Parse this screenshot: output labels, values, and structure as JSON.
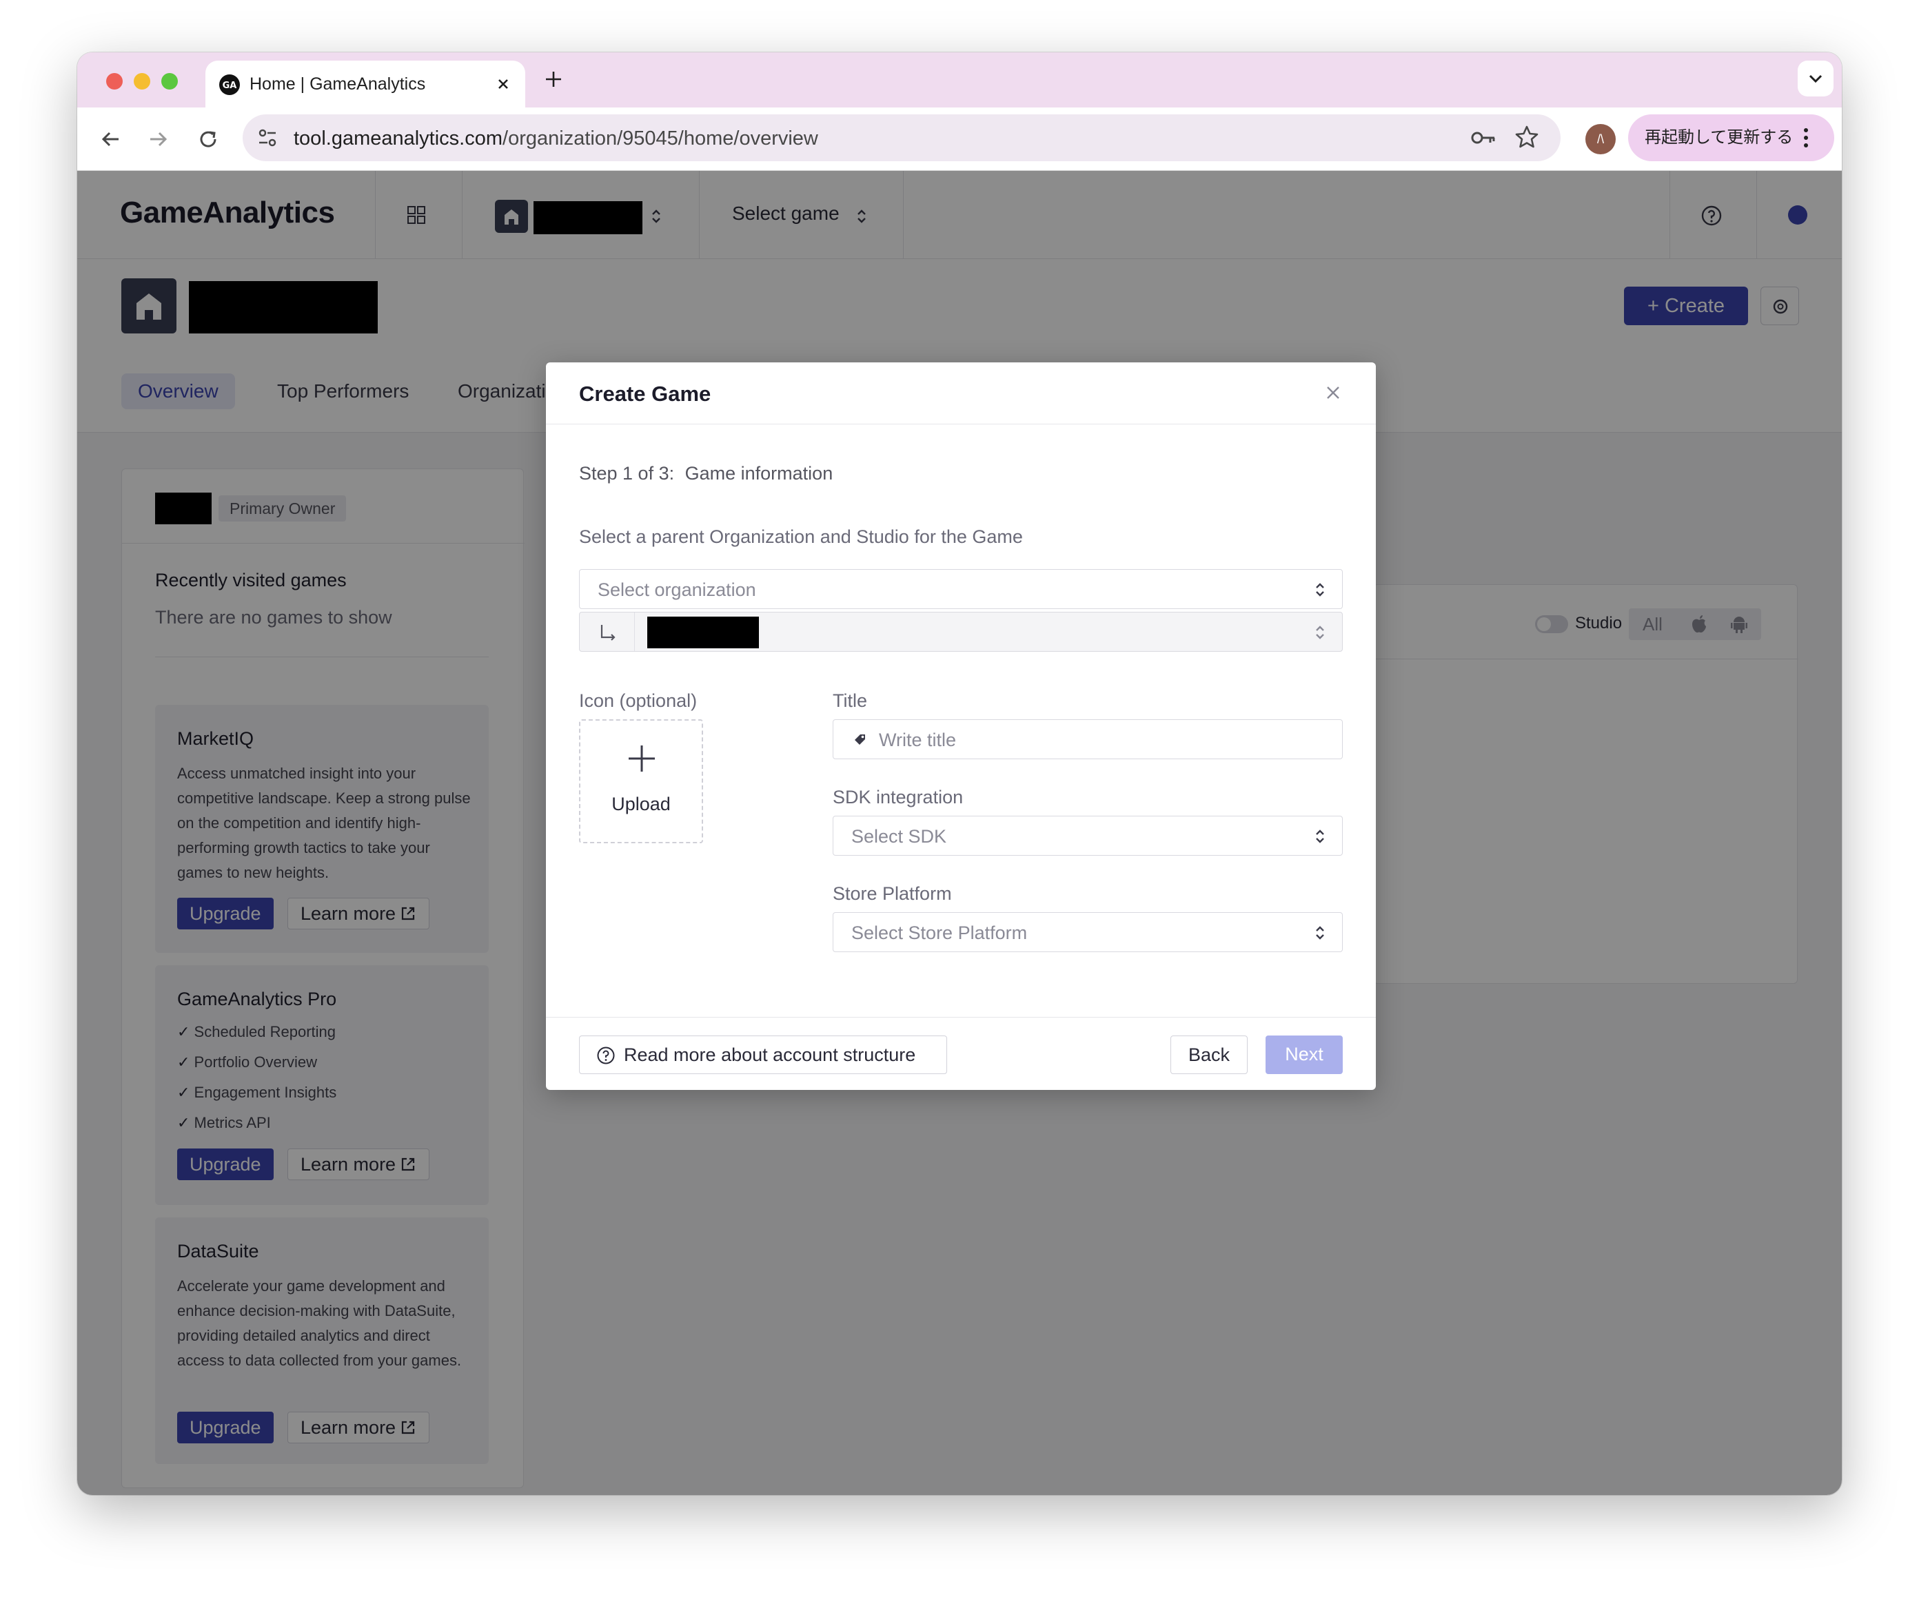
{
  "browser": {
    "tab_title": "Home | GameAnalytics",
    "url_host": "tool.gameanalytics.com",
    "url_path": "/organization/95045/home/overview",
    "relaunch_label": "再起動して更新する",
    "profile_initial": "/\\"
  },
  "app": {
    "logo": "GameAnalytics",
    "select_game": "Select game",
    "create_label": "Create",
    "tabs": [
      "Overview",
      "Top Performers",
      "Organization"
    ],
    "owner_badge": "Primary Owner",
    "recent_title": "Recently visited games",
    "recent_empty": "There are no games to show",
    "studio_toggle": "Studio",
    "filter_all": "All",
    "cards": [
      {
        "title": "MarketIQ",
        "desc": "Access unmatched insight into your competitive landscape. Keep a strong pulse on the competition and identify high-performing growth tactics to take your games to new heights.",
        "upgrade": "Upgrade",
        "learn_more": "Learn more"
      },
      {
        "title": "GameAnalytics Pro",
        "features": [
          "Scheduled Reporting",
          "Portfolio Overview",
          "Engagement Insights",
          "Metrics API"
        ],
        "upgrade": "Upgrade",
        "learn_more": "Learn more"
      },
      {
        "title": "DataSuite",
        "desc": "Accelerate your game development and enhance decision-making with DataSuite, providing detailed analytics and direct access to data collected from your games.",
        "upgrade": "Upgrade",
        "learn_more": "Learn more"
      }
    ]
  },
  "modal": {
    "title": "Create Game",
    "step_prefix": "Step 1 of 3:",
    "step_name": "Game information",
    "parent_label": "Select a parent Organization and Studio for the Game",
    "org_placeholder": "Select organization",
    "icon_label": "Icon (optional)",
    "upload_label": "Upload",
    "title_label": "Title",
    "title_placeholder": "Write title",
    "sdk_label": "SDK integration",
    "sdk_placeholder": "Select SDK",
    "store_label": "Store Platform",
    "store_placeholder": "Select Store Platform",
    "read_more": "Read more about account structure",
    "back": "Back",
    "next": "Next"
  },
  "colors": {
    "accent": "#3b44b0",
    "next_disabled": "#aab0ec",
    "tabbar": "#f0dcef"
  }
}
